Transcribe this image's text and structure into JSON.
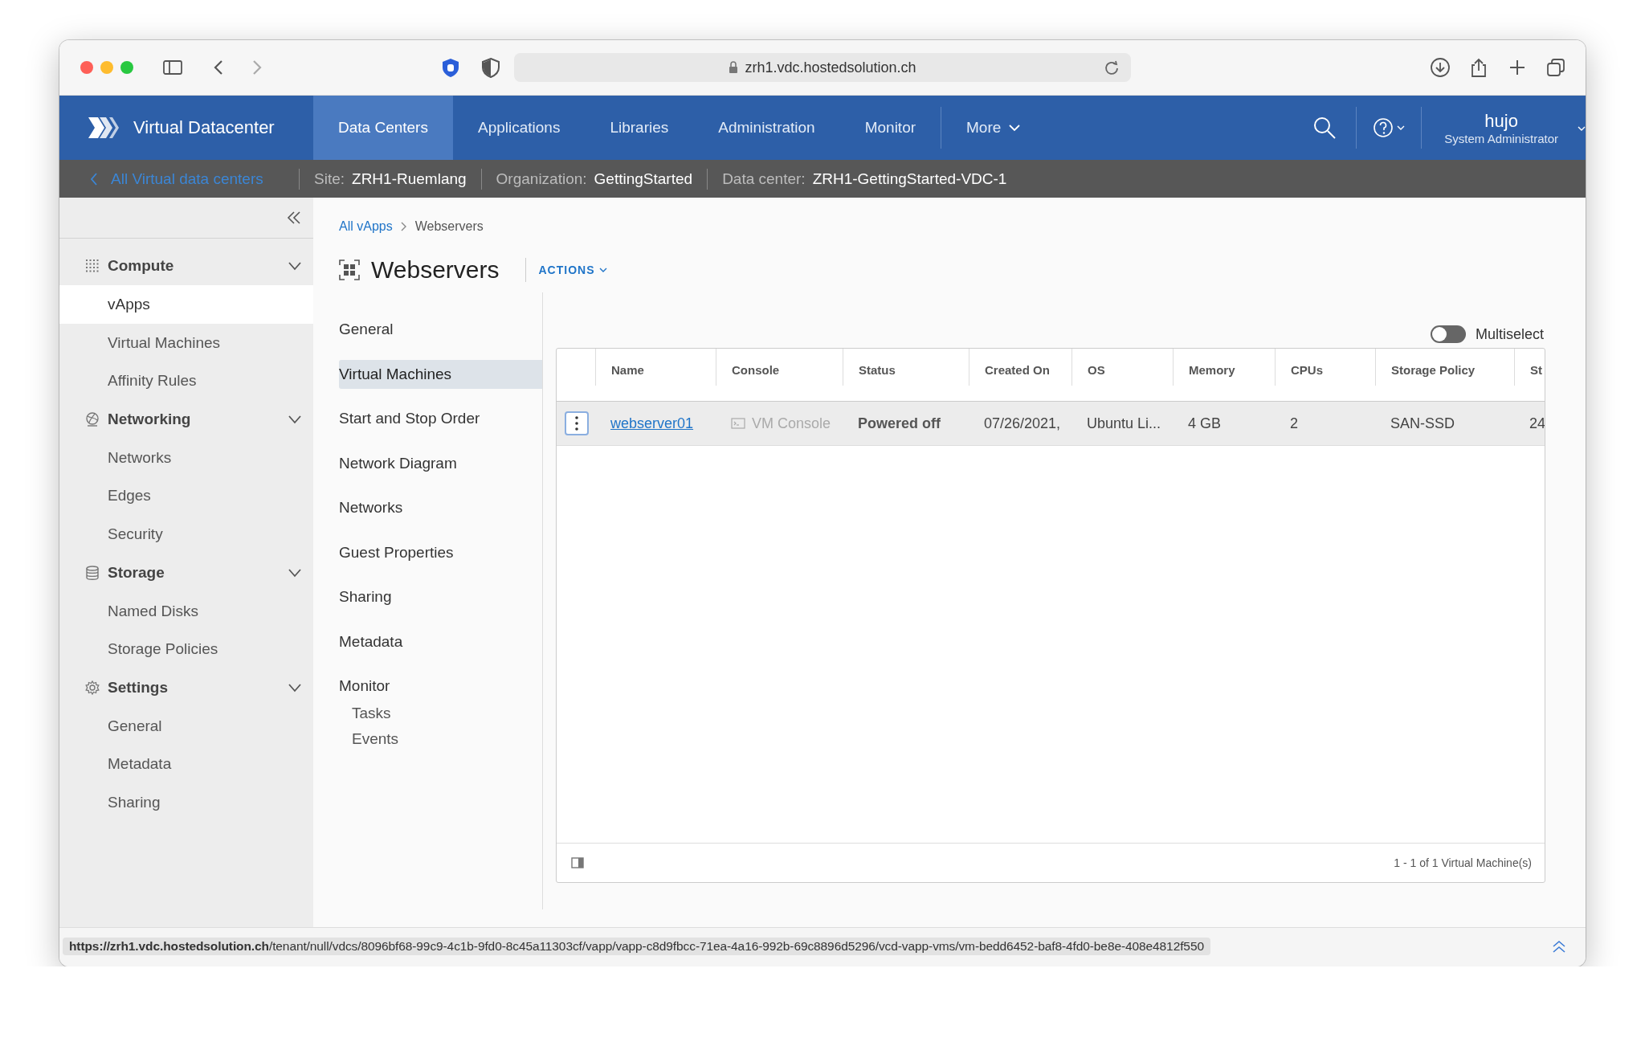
{
  "browser": {
    "url": "zrh1.vdc.hostedsolution.ch"
  },
  "app": {
    "title": "Virtual Datacenter",
    "nav": [
      {
        "label": "Data Centers",
        "selected": true
      },
      {
        "label": "Applications",
        "selected": false
      },
      {
        "label": "Libraries",
        "selected": false
      },
      {
        "label": "Administration",
        "selected": false
      },
      {
        "label": "Monitor",
        "selected": false
      }
    ],
    "more": "More",
    "user": {
      "name": "hujo",
      "role": "System Administrator"
    }
  },
  "context_bar": {
    "back_link": "All Virtual data centers",
    "items": [
      {
        "label": "Site:",
        "value": "ZRH1-Ruemlang"
      },
      {
        "label": "Organization:",
        "value": "GettingStarted"
      },
      {
        "label": "Data center:",
        "value": "ZRH1-GettingStarted-VDC-1"
      }
    ]
  },
  "sidebar": {
    "groups": [
      {
        "label": "Compute",
        "expanded": true,
        "items": [
          {
            "label": "vApps",
            "selected": true
          },
          {
            "label": "Virtual Machines",
            "selected": false
          },
          {
            "label": "Affinity Rules",
            "selected": false
          }
        ]
      },
      {
        "label": "Networking",
        "expanded": true,
        "items": [
          {
            "label": "Networks",
            "selected": false
          },
          {
            "label": "Edges",
            "selected": false
          },
          {
            "label": "Security",
            "selected": false
          }
        ]
      },
      {
        "label": "Storage",
        "expanded": true,
        "items": [
          {
            "label": "Named Disks",
            "selected": false
          },
          {
            "label": "Storage Policies",
            "selected": false
          }
        ]
      },
      {
        "label": "Settings",
        "expanded": true,
        "items": [
          {
            "label": "General",
            "selected": false
          },
          {
            "label": "Metadata",
            "selected": false
          },
          {
            "label": "Sharing",
            "selected": false
          }
        ]
      }
    ]
  },
  "breadcrumb": {
    "link": "All vApps",
    "current": "Webservers"
  },
  "page": {
    "title": "Webservers",
    "actions": "ACTIONS"
  },
  "subnav": [
    {
      "label": "General",
      "selected": false
    },
    {
      "label": "Virtual Machines",
      "selected": true
    },
    {
      "label": "Start and Stop Order",
      "selected": false
    },
    {
      "label": "Network Diagram",
      "selected": false
    },
    {
      "label": "Networks",
      "selected": false
    },
    {
      "label": "Guest Properties",
      "selected": false
    },
    {
      "label": "Sharing",
      "selected": false
    },
    {
      "label": "Metadata",
      "selected": false
    },
    {
      "label": "Monitor",
      "selected": false,
      "children": [
        {
          "label": "Tasks",
          "selected": false
        },
        {
          "label": "Events",
          "selected": false
        }
      ]
    }
  ],
  "multiselect": {
    "label": "Multiselect",
    "on": false
  },
  "table": {
    "columns": [
      "Name",
      "Console",
      "Status",
      "Created On",
      "OS",
      "Memory",
      "CPUs",
      "Storage Policy",
      "St"
    ],
    "rows": [
      {
        "name": "webserver01",
        "console": "VM Console",
        "status": "Powered off",
        "created_on": "07/26/2021,",
        "os": "Ubuntu Li...",
        "memory": "4 GB",
        "cpus": "2",
        "storage_policy": "SAN-SSD",
        "column_9": "24"
      }
    ],
    "footer": "1 - 1 of 1 Virtual Machine(s)"
  },
  "status_bar": {
    "url": "**https://zrh1.vdc.hostedsolution.ch**/tenant/null/vdcs/8096bf68-99c9-4c1b-9fd0-8c45a11303cf/vapp/vapp-c8d9fbcc-71ea-4a16-992b-69c8896d5296/vcd-vapp-vms/vm-bedd6452-baf8-4fd0-be8e-408e4812f550"
  }
}
